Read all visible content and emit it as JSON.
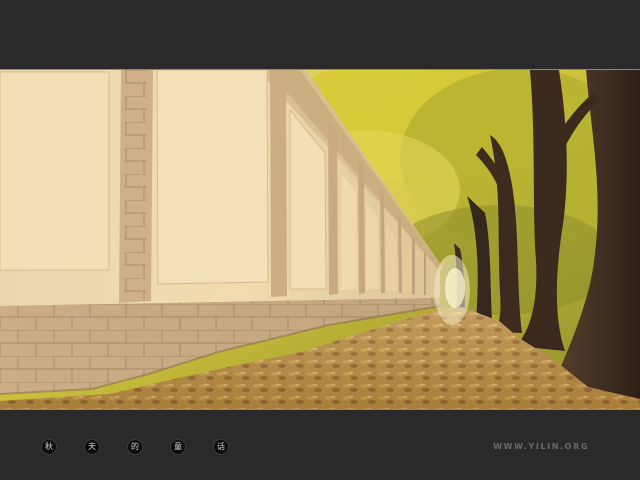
{
  "caption": {
    "characters": [
      "秋",
      "天",
      "的",
      "童",
      "话"
    ]
  },
  "watermark": {
    "text": "WWW.YILIN.ORG"
  },
  "palette": {
    "frame": "#2a2a2a",
    "wall": "#ecd7ae",
    "stone": "#d2b28a",
    "foliage": "#d8cf46",
    "trunk": "#4b3424",
    "leaves_ground": "#b88b3f"
  }
}
